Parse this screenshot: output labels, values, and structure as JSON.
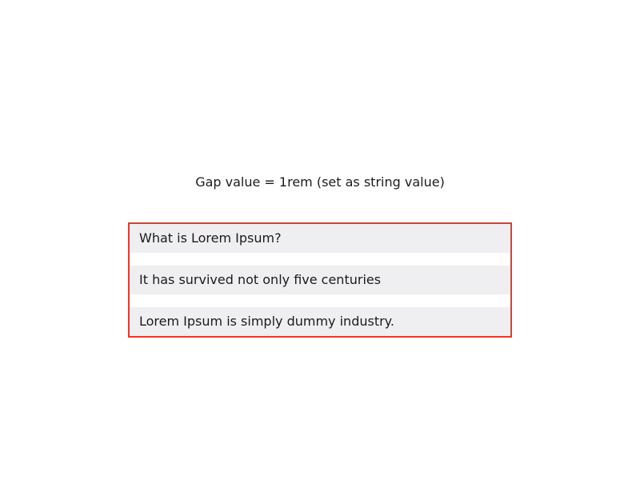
{
  "caption": "Gap value = 1rem (set as string value)",
  "stack": {
    "border_color": "#e33b2e",
    "item_background": "#efeef0",
    "items": [
      {
        "label": "What is Lorem Ipsum?"
      },
      {
        "label": "It has survived not only five centuries"
      },
      {
        "label": "Lorem Ipsum is simply dummy industry."
      }
    ]
  }
}
